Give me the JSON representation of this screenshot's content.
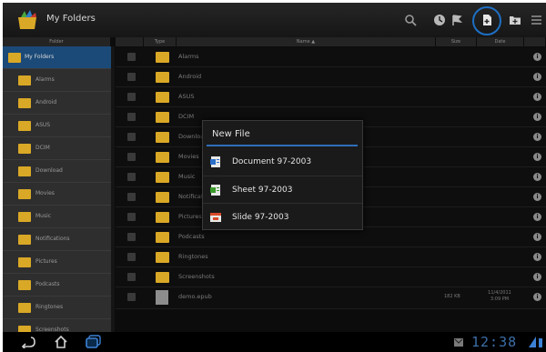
{
  "app": {
    "title": "My Folders"
  },
  "toolbar": {
    "search_icon": "search-icon",
    "history_icon": "recent-icon",
    "new_file_icon": "new-file-icon",
    "new_folder_icon": "new-folder-icon",
    "menu_icon": "menu-icon"
  },
  "headers": {
    "folder": "Folder",
    "type": "Type",
    "name": "Name ▲",
    "size": "Size",
    "date": "Date"
  },
  "tree": {
    "root": "My Folders",
    "items": [
      "Alarms",
      "Android",
      "ASUS",
      "DCIM",
      "Download",
      "Movies",
      "Music",
      "Notifications",
      "Pictures",
      "Podcasts",
      "Ringtones",
      "Screenshots"
    ]
  },
  "files": [
    {
      "name": "Alarms"
    },
    {
      "name": "Android"
    },
    {
      "name": "ASUS"
    },
    {
      "name": "DCIM"
    },
    {
      "name": "Download"
    },
    {
      "name": "Movies"
    },
    {
      "name": "Music"
    },
    {
      "name": "Notifications"
    },
    {
      "name": "Pictures"
    },
    {
      "name": "Podcasts"
    },
    {
      "name": "Ringtones"
    },
    {
      "name": "Screenshots"
    },
    {
      "name": "demo.epub",
      "size": "182 KB",
      "date": "11/4/2011",
      "time": "3:09 PM"
    }
  ],
  "dialog": {
    "title": "New File",
    "items": [
      {
        "label": "Document 97-2003",
        "icon": "word-document-icon",
        "color": "#2b6fc9"
      },
      {
        "label": "Sheet 97-2003",
        "icon": "excel-sheet-icon",
        "color": "#3a9a2a"
      },
      {
        "label": "Slide 97-2003",
        "icon": "powerpoint-slide-icon",
        "color": "#d84a2a"
      }
    ]
  },
  "navbar": {
    "clock": "12:38"
  },
  "colors": {
    "accent": "#1d6fc4",
    "folder": "#d9a826",
    "selected": "#1b4a78"
  }
}
